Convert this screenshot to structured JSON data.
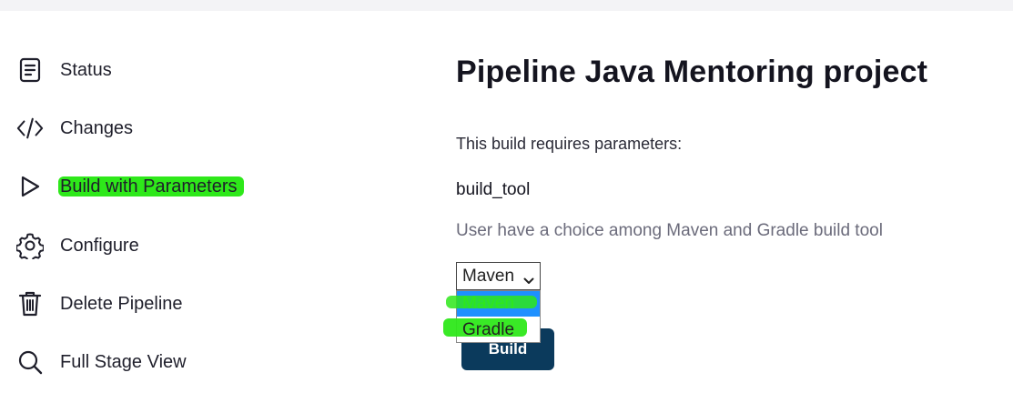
{
  "sidebar": {
    "items": [
      {
        "label": "Status",
        "icon": "document-icon"
      },
      {
        "label": "Changes",
        "icon": "code-icon"
      },
      {
        "label": "Build with Parameters",
        "icon": "play-icon"
      },
      {
        "label": "Configure",
        "icon": "gear-icon"
      },
      {
        "label": "Delete Pipeline",
        "icon": "trash-icon"
      },
      {
        "label": "Full Stage View",
        "icon": "search-icon"
      }
    ]
  },
  "main": {
    "title": "Pipeline Java Mentoring project",
    "requires_text": "This build requires parameters:",
    "parameter": {
      "name": "build_tool",
      "description": "User have a choice among Maven and Gradle build tool",
      "selected": "Maven",
      "options": [
        "Maven",
        "Gradle"
      ]
    },
    "build_label": "Build"
  },
  "colors": {
    "highlight": "#2ee81a",
    "build_button": "#0b3a5c",
    "option_selected_bg": "#1e90ff"
  }
}
